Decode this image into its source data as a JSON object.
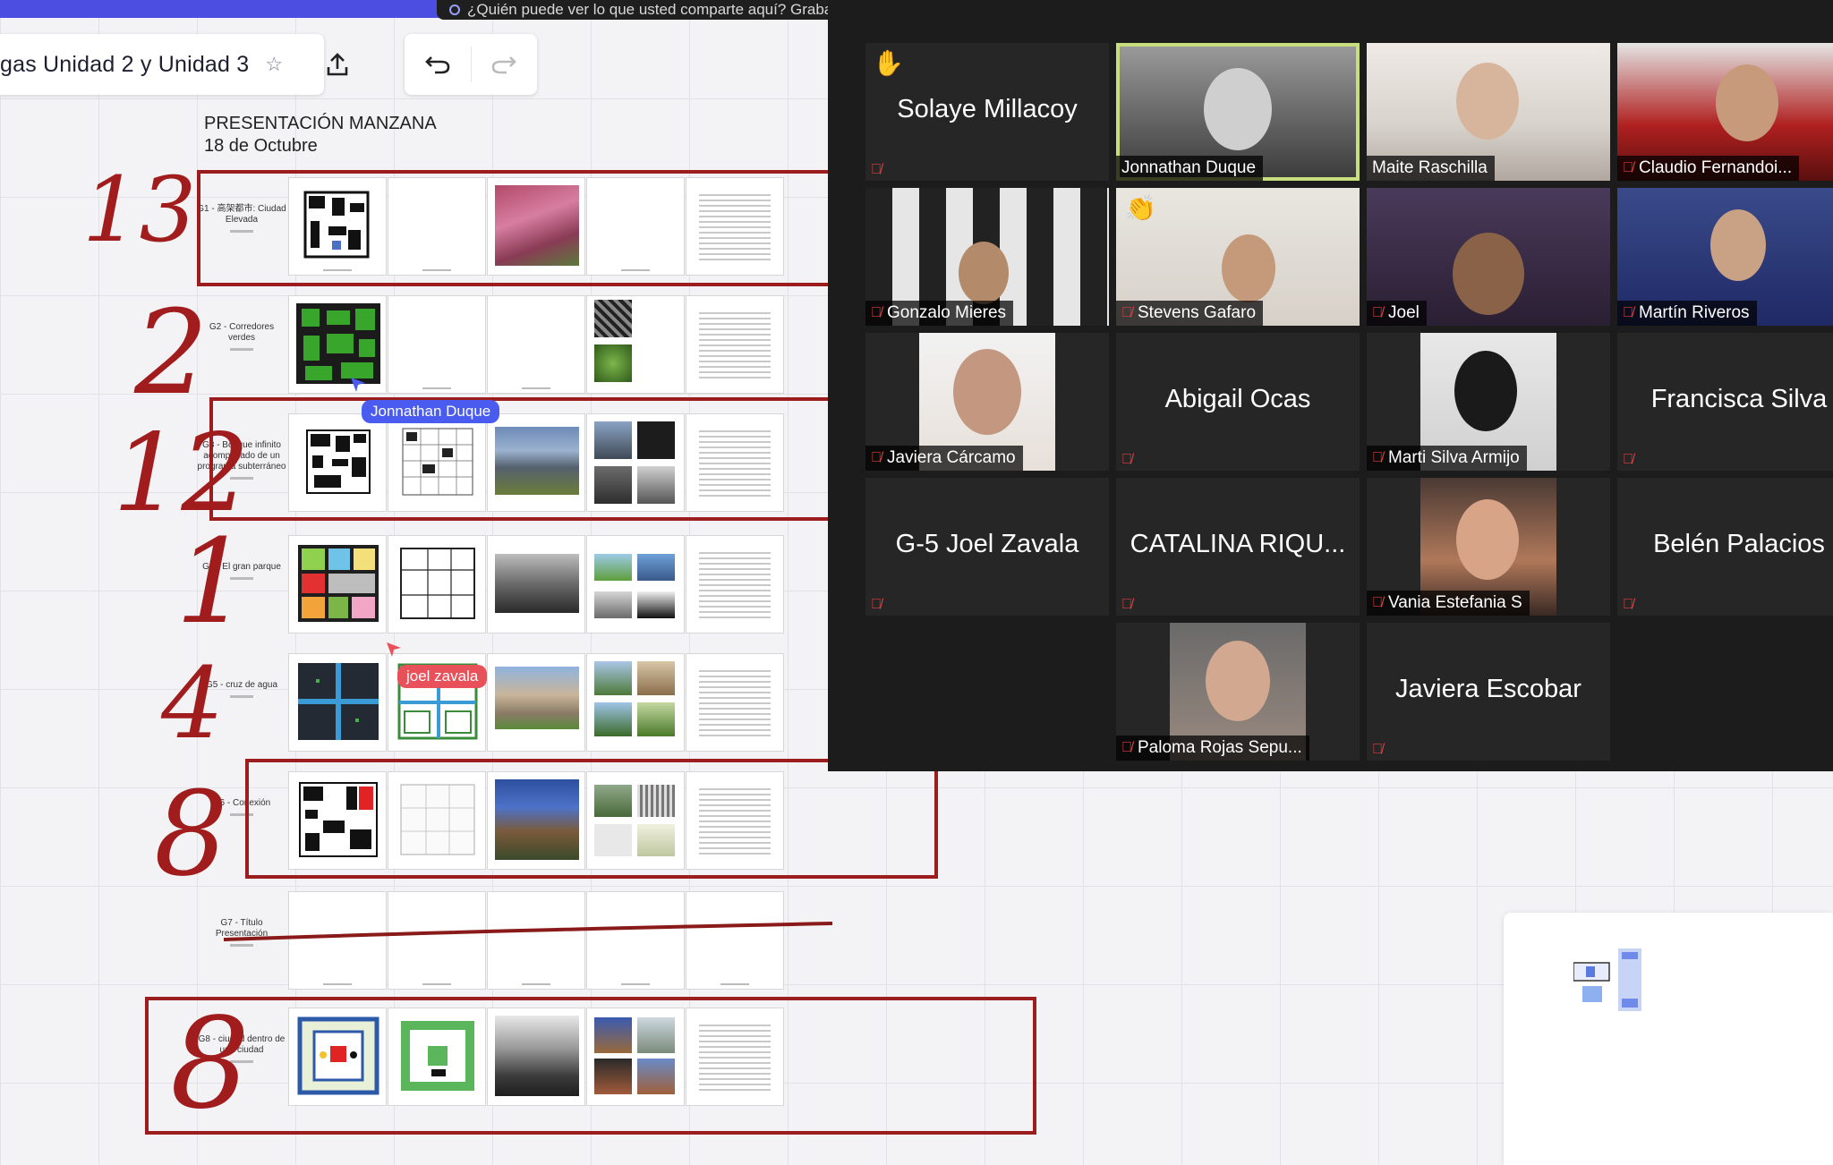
{
  "banner": {
    "text": "¿Quién puede ver lo que usted comparte aquí? Grabación activada"
  },
  "toolbar": {
    "board_title": "gas Unidad 2 y Unidad 3"
  },
  "presentation": {
    "title": "PRESENTACIÓN MANZANA",
    "date": "18 de Octubre"
  },
  "rows": [
    {
      "label": "G1 - 高架都市: Ciudad Elevada"
    },
    {
      "label": "G2 - Corredores verdes"
    },
    {
      "label": "G3 - Bosque infinito acompañado de un programa subterráneo"
    },
    {
      "label": "G4 - El gran parque"
    },
    {
      "label": "G5 - cruz de agua"
    },
    {
      "label": "G6 - Conexión"
    },
    {
      "label": "G7 - Título Presentación"
    },
    {
      "label": "G8 - ciudad dentro de una ciudad"
    }
  ],
  "annotations": [
    "13",
    "2",
    "12",
    "1",
    "4",
    "8",
    "8"
  ],
  "cursors": [
    {
      "name": "Jonnathan Duque",
      "color": "#4a5cf0"
    },
    {
      "name": "joel zavala",
      "color": "#e8505a"
    }
  ],
  "participants": [
    {
      "name": "Solaye Millacoy",
      "video": false,
      "hand": true
    },
    {
      "name": "Jonnathan Duque",
      "video": true,
      "active": true
    },
    {
      "name": "Maite Raschilla",
      "video": true
    },
    {
      "name": "Claudio Fernandoi...",
      "video": true
    },
    {
      "name": "Gonzalo Mieres",
      "video": true
    },
    {
      "name": "Stevens Gafaro",
      "video": true
    },
    {
      "name": "Joel",
      "video": true
    },
    {
      "name": "Martín Riveros",
      "video": true
    },
    {
      "name": "Javiera Cárcamo",
      "video": true
    },
    {
      "name": "Abigail Ocas",
      "video": false
    },
    {
      "name": "Marti Silva Armijo",
      "video": true
    },
    {
      "name": "Francisca Silva",
      "video": false
    },
    {
      "name": "G-5 Joel Zavala",
      "video": false
    },
    {
      "name": "CATALINA RIQU...",
      "video": false
    },
    {
      "name": "Vania Estefania S",
      "video": true
    },
    {
      "name": "Belén Palacios",
      "video": false
    },
    {
      "name": "Paloma Rojas Sepu...",
      "video": true
    },
    {
      "name": "Javiera Escobar",
      "video": false
    }
  ]
}
